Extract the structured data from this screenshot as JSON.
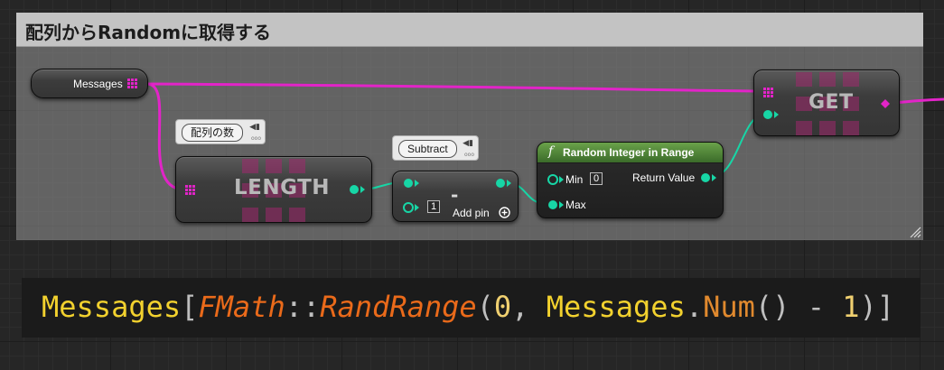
{
  "comment": {
    "title": "配列からRandomに取得する"
  },
  "nodes": {
    "messages_var": {
      "label": "Messages"
    },
    "length": {
      "label": "LENGTH",
      "bubble": "配列の数"
    },
    "subtract": {
      "symbol": "-",
      "bubble": "Subtract",
      "input_value": "1",
      "add_pin_label": "Add pin"
    },
    "random_int": {
      "title": "Random Integer in Range",
      "min_label": "Min",
      "min_value": "0",
      "max_label": "Max",
      "return_label": "Return Value"
    },
    "get": {
      "label": "GET"
    }
  },
  "code": {
    "t1": "Messages",
    "t2": "[",
    "t3": "FMath",
    "t4": "::",
    "t5": "RandRange",
    "t6": "(",
    "t7": "0",
    "t8": ", ",
    "t9": "Messages",
    "t10": ".",
    "t11": "Num",
    "t12": "() - ",
    "t13": "1",
    "t14": ")]"
  },
  "colors": {
    "array_wire": "#e224c8",
    "int_wire": "#17d6a6",
    "function_header": "#4f8a35"
  },
  "bubble_icons": {
    "pin": "pin-icon",
    "sub": "ooo"
  }
}
